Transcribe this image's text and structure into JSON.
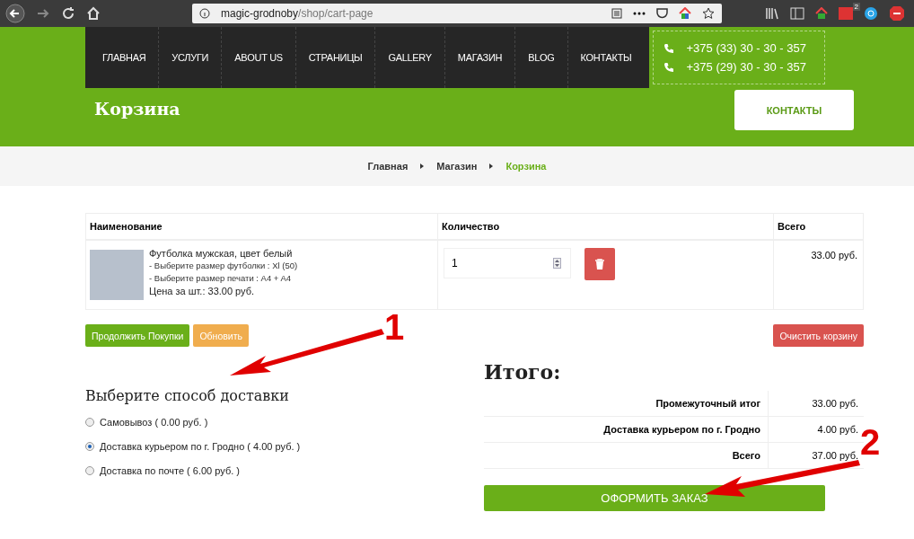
{
  "browser": {
    "url_host": "magic-grodnoby",
    "url_path": "/shop/cart-page",
    "badge": "2"
  },
  "nav": {
    "items": [
      "ГЛАВНАЯ",
      "УСЛУГИ",
      "ABOUT US",
      "СТРАНИЦЫ",
      "GALLERY",
      "МАГАЗИН",
      "BLOG",
      "КОНТАКТЫ"
    ],
    "phones": [
      "+375 (33) 30 - 30 - 357",
      "+375 (29) 30 - 30 - 357"
    ]
  },
  "page_title": "Корзина",
  "contacts_button": "КОНТАКТЫ",
  "breadcrumbs": [
    {
      "label": "Главная",
      "selected": false
    },
    {
      "label": "Магазин",
      "selected": false
    },
    {
      "label": "Корзина",
      "selected": true
    }
  ],
  "cart": {
    "columns": [
      "Наименование",
      "Количество",
      "Всего"
    ],
    "rows": [
      {
        "name": "Футболка мужская, цвет белый",
        "options": [
          "- Выберите размер футболки : Xl (50)",
          "- Выберите размер печати : A4 + A4"
        ],
        "price": "Цена за шт.: 33.00 руб.",
        "quantity": "1",
        "total": "33.00 руб."
      }
    ]
  },
  "buttons": {
    "continue": "Продолжить Покупки",
    "update": "Обновить",
    "clear": "Очистить корзину"
  },
  "delivery": {
    "title": "Выберите способ доставки",
    "options": [
      {
        "label": "Самовывоз ( 0.00 руб. )",
        "selected": false
      },
      {
        "label": "Доставка курьером по г. Гродно ( 4.00 руб. )",
        "selected": true
      },
      {
        "label": "Доставка по почте ( 6.00 руб. )",
        "selected": false
      }
    ]
  },
  "totals": {
    "title": "Итого:",
    "rows": [
      {
        "label": "Промежуточный итог",
        "value": "33.00 руб."
      },
      {
        "label": "Доставка курьером по г. Гродно",
        "value": "4.00 руб."
      },
      {
        "label": "Всего",
        "value": "37.00 руб."
      }
    ],
    "order_button": "ОФОРМИТЬ ЗАКАЗ"
  },
  "annotations": [
    "1",
    "2"
  ]
}
